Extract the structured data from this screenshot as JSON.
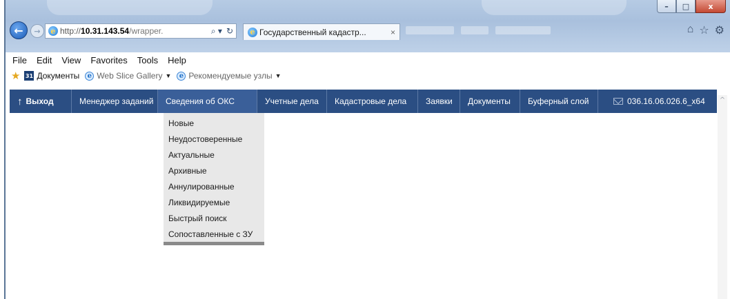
{
  "browser": {
    "address": {
      "scheme": "http://",
      "host": "10.31.143.54",
      "path": "/wrapper.",
      "search_glyph": "⌕ ▾",
      "refresh_glyph": "↻"
    },
    "active_tab": {
      "title": "Государственный кадастр...",
      "close": "×"
    },
    "controls": {
      "minimize": "–",
      "maximize": "□",
      "close": "x"
    },
    "toolbar_icons": {
      "home": "⌂",
      "favorites": "☆",
      "settings": "⚙"
    }
  },
  "menubar": [
    "File",
    "Edit",
    "View",
    "Favorites",
    "Tools",
    "Help"
  ],
  "favbar": {
    "badge": "31",
    "items": [
      {
        "label": "Документы"
      },
      {
        "label": "Web Slice Gallery"
      },
      {
        "label": "Рекомендуемые узлы"
      }
    ]
  },
  "appnav": {
    "items": [
      {
        "label": "Выход"
      },
      {
        "label": "Менеджер заданий"
      },
      {
        "label": "Сведения об ОКС"
      },
      {
        "label": "Учетные дела"
      },
      {
        "label": "Кадастровые дела"
      },
      {
        "label": "Заявки"
      },
      {
        "label": "Документы"
      },
      {
        "label": "Буферный слой"
      },
      {
        "label": "036.16.06.026.6_x64"
      }
    ],
    "colors": {
      "bar": "#2b4e83",
      "active": "#3a5f99",
      "text": "#ffffff"
    }
  },
  "dropdown": {
    "items": [
      {
        "label": "Новые"
      },
      {
        "label": "Неудостоверенные"
      },
      {
        "label": "Актуальные"
      },
      {
        "label": "Архивные"
      },
      {
        "label": "Аннулированные"
      },
      {
        "label": "Ликвидируемые"
      },
      {
        "label": "Быстрый поиск"
      },
      {
        "label": "Сопоставленные с ЗУ"
      }
    ]
  },
  "scrollbar": {
    "up_glyph": "^"
  }
}
